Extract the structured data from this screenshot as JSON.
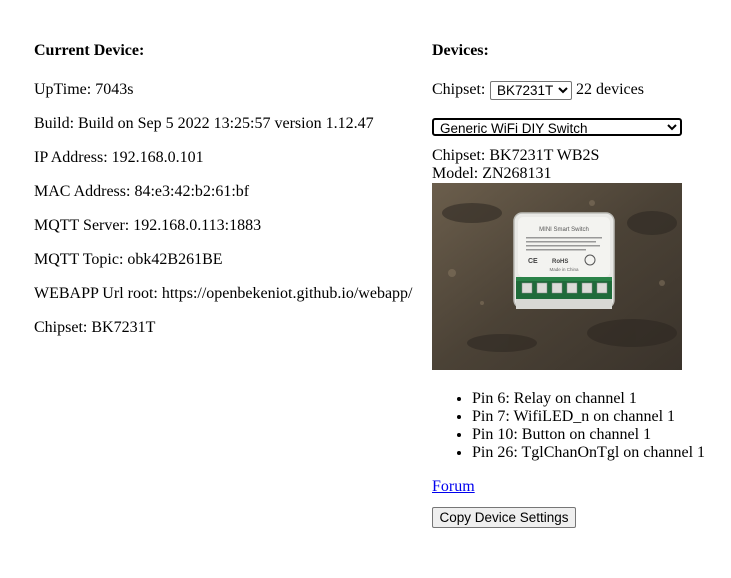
{
  "current": {
    "heading": "Current Device:",
    "uptime": "UpTime: 7043s",
    "build": "Build: Build on Sep 5 2022 13:25:57 version 1.12.47",
    "ip": "IP Address: 192.168.0.101",
    "mac": "MAC Address: 84:e3:42:b2:61:bf",
    "mqtt_server": "MQTT Server: 192.168.0.113:1883",
    "mqtt_topic": "MQTT Topic: obk42B261BE",
    "webapp": "WEBAPP Url root: https://openbekeniot.github.io/webapp/",
    "chipset": "Chipset: BK7231T"
  },
  "devices": {
    "heading": "Devices:",
    "chipset_label": "Chipset:",
    "chipset_selected": "BK7231T",
    "device_count": "22 devices",
    "device_selected": "Generic WiFi DIY Switch",
    "detail_chipset": "Chipset: BK7231T WB2S",
    "detail_model": "Model: ZN268131",
    "image_text": {
      "title": "MINI Smart Switch",
      "ce": "CE",
      "rohs": "RoHS",
      "made": "Made in China"
    },
    "pins": [
      "Pin 6: Relay on channel 1",
      "Pin 7: WifiLED_n on channel 1",
      "Pin 10: Button on channel 1",
      "Pin 26: TglChanOnTgl on channel 1"
    ],
    "forum_link": "Forum",
    "copy_button": "Copy Device Settings"
  }
}
